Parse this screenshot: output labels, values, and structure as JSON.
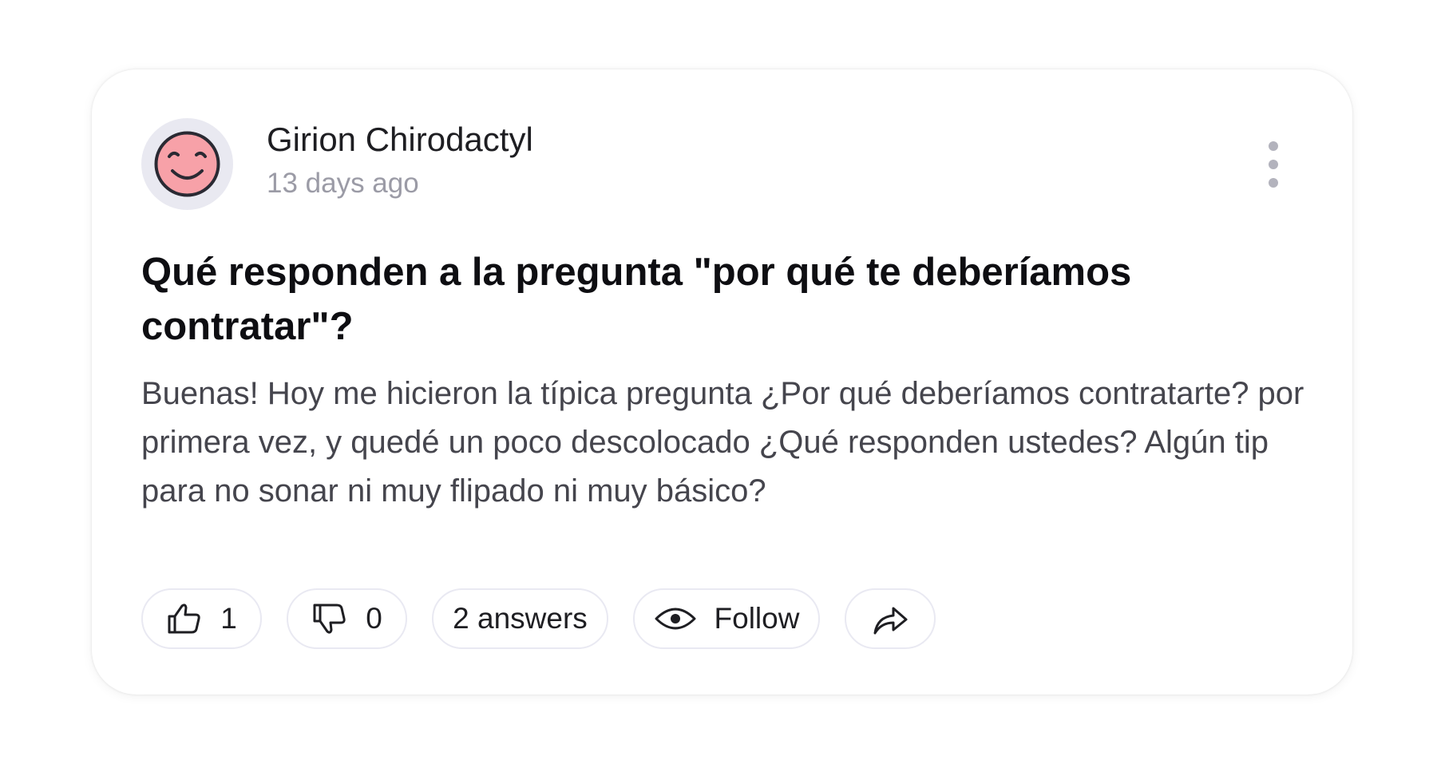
{
  "post": {
    "author": "Girion Chirodactyl",
    "time_ago": "13 days ago",
    "avatar_icon": "smiling-face-icon",
    "avatar_color": "#f7a1a8",
    "title": "Qué responden a la pregunta \"por qué te deberíamos contratar\"?",
    "body": "Buenas! Hoy me hicieron la típica pregunta ¿Por qué deberíamos contratarte? por primera vez, y quedé un poco descolocado ¿Qué responden ustedes? Algún tip para no sonar ni muy flipado ni muy básico?"
  },
  "menu": {
    "icon": "more-vertical-icon"
  },
  "actions": {
    "upvote": {
      "icon": "thumbs-up-icon",
      "count": "1"
    },
    "downvote": {
      "icon": "thumbs-down-icon",
      "count": "0"
    },
    "answers": {
      "label": "2 answers"
    },
    "follow": {
      "icon": "eye-icon",
      "label": "Follow"
    },
    "share": {
      "icon": "share-arrow-icon"
    }
  }
}
